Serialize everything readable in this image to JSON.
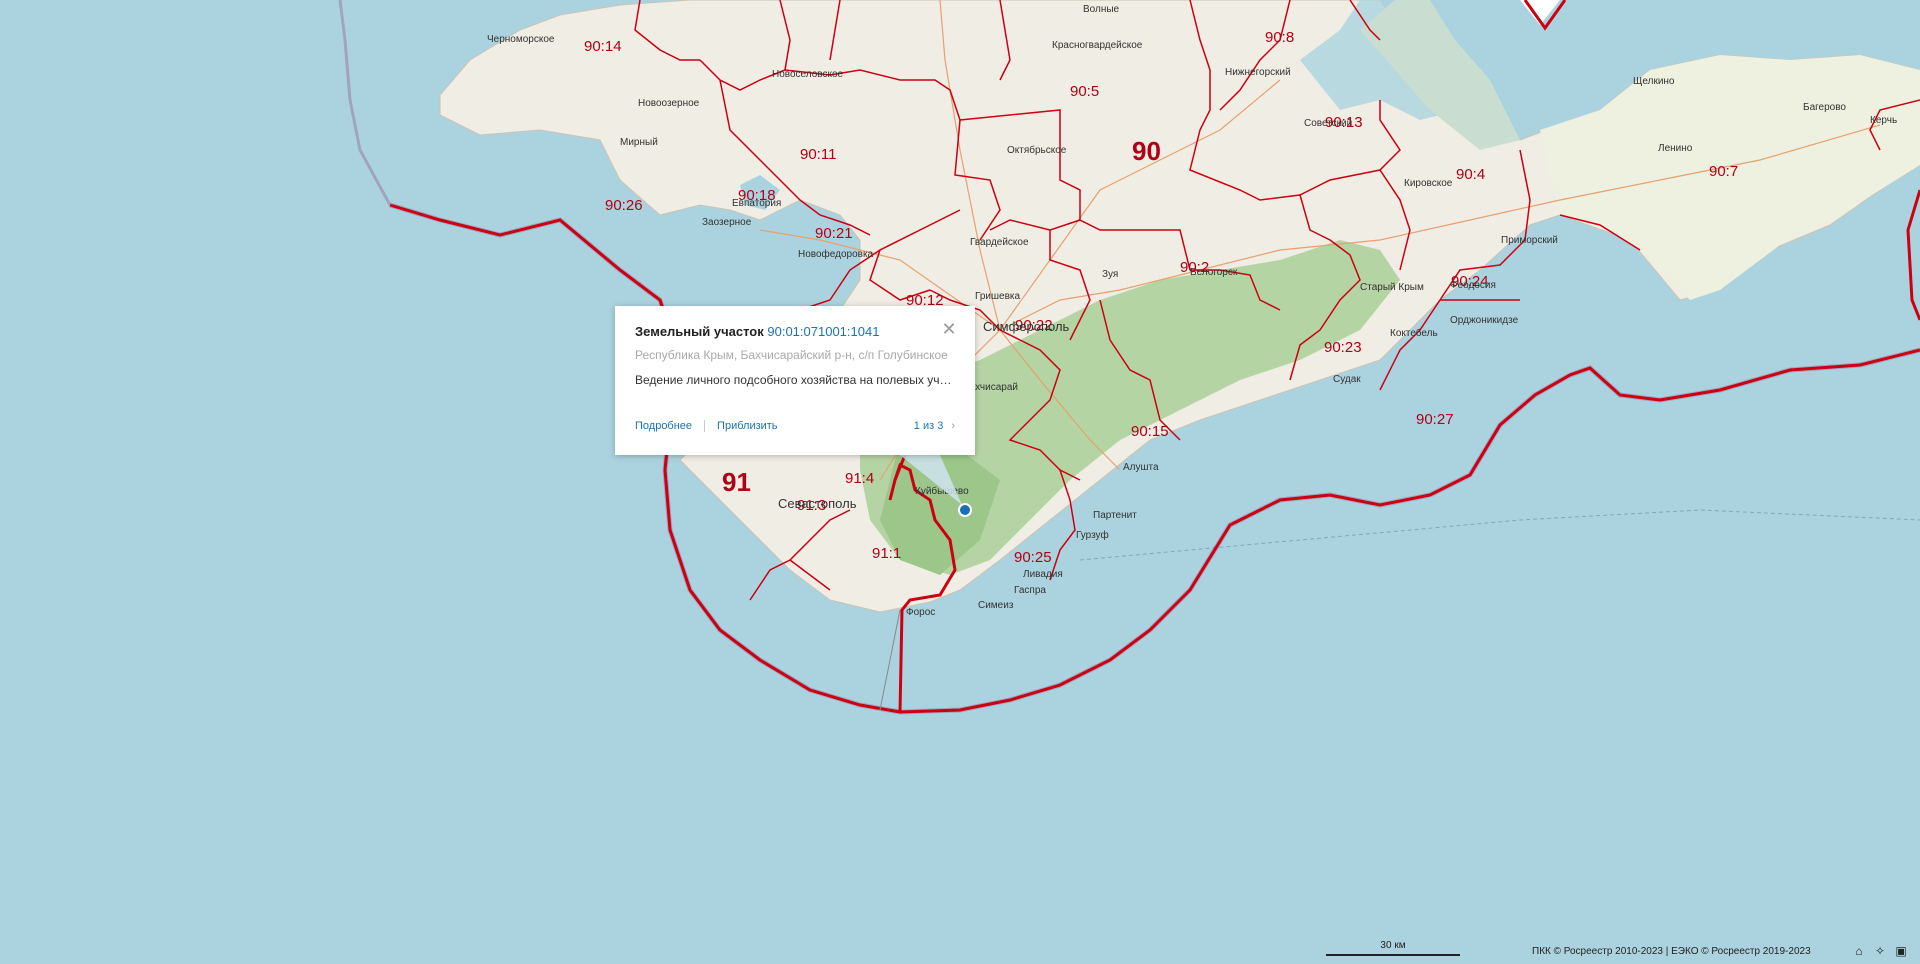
{
  "map": {
    "region_labels": [
      {
        "text": "90:14"
      },
      {
        "text": "90:8"
      },
      {
        "text": "90:5"
      },
      {
        "text": "90:13"
      },
      {
        "text": "90:11"
      },
      {
        "text": "90"
      },
      {
        "text": "90:4"
      },
      {
        "text": "90:7"
      },
      {
        "text": "90:26"
      },
      {
        "text": "90:18"
      },
      {
        "text": "90:21"
      },
      {
        "text": "90:2"
      },
      {
        "text": "90:12"
      },
      {
        "text": "90:24"
      },
      {
        "text": "90:22"
      },
      {
        "text": "90:23"
      },
      {
        "text": "90:27"
      },
      {
        "text": "90:15"
      },
      {
        "text": "91"
      },
      {
        "text": "91:4"
      },
      {
        "text": "91:3"
      },
      {
        "text": "91:1"
      },
      {
        "text": "90:25"
      }
    ],
    "town_labels": [
      {
        "text": "Черноморское"
      },
      {
        "text": "Волные"
      },
      {
        "text": "Красногвардейское"
      },
      {
        "text": "Нижнегорский"
      },
      {
        "text": "Новоселовское"
      },
      {
        "text": "Новоозерное"
      },
      {
        "text": "Щелкино"
      },
      {
        "text": "Багерово"
      },
      {
        "text": "Керчь"
      },
      {
        "text": "Мирный"
      },
      {
        "text": "Октябрьское"
      },
      {
        "text": "Советский"
      },
      {
        "text": "Ленино"
      },
      {
        "text": "Кировское"
      },
      {
        "text": "Евпатория"
      },
      {
        "text": "Заозерное"
      },
      {
        "text": "Новофедоровка"
      },
      {
        "text": "Гвардейское"
      },
      {
        "text": "Приморский"
      },
      {
        "text": "Зуя"
      },
      {
        "text": "Белогорск"
      },
      {
        "text": "Старый Крым"
      },
      {
        "text": "Феодосия"
      },
      {
        "text": "Гришевка"
      },
      {
        "text": "Симферополь"
      },
      {
        "text": "Коктебель"
      },
      {
        "text": "Орджоникидзе"
      },
      {
        "text": "Судак"
      },
      {
        "text": "Алушта"
      },
      {
        "text": "Куйбышево"
      },
      {
        "text": "Партенит"
      },
      {
        "text": "Гурзуф"
      },
      {
        "text": "Севастополь"
      },
      {
        "text": "Ливадия"
      },
      {
        "text": "Гаспра"
      },
      {
        "text": "Симеиз"
      },
      {
        "text": "Форос"
      },
      {
        "text": "Бахчисарай"
      }
    ]
  },
  "popup": {
    "type_label": "Земельный участок",
    "cadastral_number": "90:01:071001:1041",
    "address": "Республика Крым, Бахчисарайский р-н, с/п Голубинское",
    "purpose": "Ведение личного подсобного хозяйства на полевых участках",
    "details_link": "Подробнее",
    "zoom_link": "Приблизить",
    "pager": "1 из 3",
    "close_icon": "close-icon",
    "next_icon": "chevron-right-icon"
  },
  "footer": {
    "scale_label": "30 км",
    "attribution": "ПКК © Росреестр 2010-2023 | ЕЭКО © Росреестр 2019-2023",
    "controls": [
      "home-icon",
      "locate-icon",
      "layers-icon"
    ]
  },
  "colors": {
    "sea": "#abd3df",
    "land": "#f0ede4",
    "forest": "#aed09b",
    "boundary": "#cc0011",
    "label": "#b00015",
    "link": "#1a73b5"
  }
}
